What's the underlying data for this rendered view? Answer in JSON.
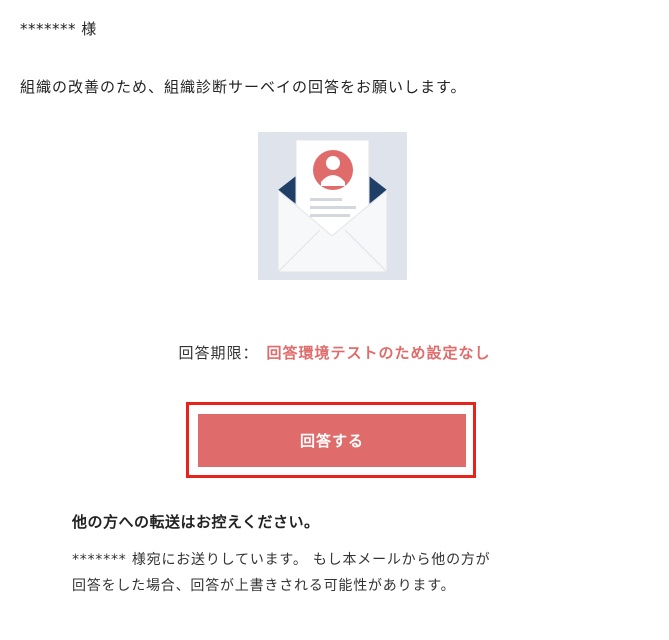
{
  "greeting": "******* 様",
  "intro": "組織の改善のため、組織診断サーベイの回答をお願いします。",
  "illustration": {
    "icon": "envelope-survey-icon",
    "accent": "#e06b6b",
    "flap": "#1f3f66",
    "background": "#dfe3ec"
  },
  "deadline": {
    "label": "回答期限：",
    "value": "回答環境テストのため設定なし"
  },
  "answer_button": {
    "label": "回答する",
    "color": "#e06b6b",
    "highlight": "#e8231c"
  },
  "forward_notice": {
    "title": "他の方への転送はお控えください。",
    "lines": [
      "******* 様宛にお送りしています。 もし本メールから他の方が",
      "回答をした場合、回答が上書きされる可能性があります。"
    ]
  }
}
